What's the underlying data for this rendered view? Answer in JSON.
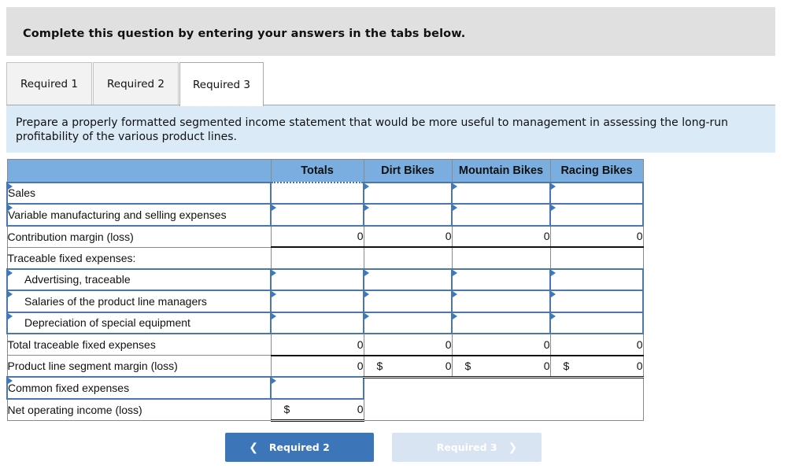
{
  "banner": {
    "text": "Complete this question by entering your answers in the tabs below."
  },
  "tabs": [
    {
      "label": "Required 1",
      "active": false
    },
    {
      "label": "Required 2",
      "active": false
    },
    {
      "label": "Required 3",
      "active": true
    }
  ],
  "instructions": "Prepare a properly formatted segmented income statement that would be more useful to management in assessing the long-run profitability of the various product lines.",
  "table": {
    "headers": [
      "",
      "Totals",
      "Dirt Bikes",
      "Mountain Bikes",
      "Racing Bikes"
    ],
    "rows": [
      {
        "label": "Sales",
        "type": "input",
        "cells": [
          "",
          "",
          "",
          ""
        ]
      },
      {
        "label": "Variable manufacturing and selling expenses",
        "type": "input",
        "cells": [
          "",
          "",
          "",
          ""
        ]
      },
      {
        "label": "Contribution margin (loss)",
        "type": "computed",
        "cells": [
          "0",
          "0",
          "0",
          "0"
        ]
      },
      {
        "label": "Traceable fixed expenses:",
        "type": "heading",
        "cells": [
          "",
          "",
          "",
          ""
        ]
      },
      {
        "label": "Advertising, traceable",
        "type": "input",
        "cells": [
          "",
          "",
          "",
          ""
        ]
      },
      {
        "label": "Salaries of the product line managers",
        "type": "input",
        "cells": [
          "",
          "",
          "",
          ""
        ]
      },
      {
        "label": "Depreciation of special equipment",
        "type": "input",
        "cells": [
          "",
          "",
          "",
          ""
        ]
      },
      {
        "label": "Total traceable fixed expenses",
        "type": "computed",
        "cells": [
          "0",
          "0",
          "0",
          "0"
        ]
      },
      {
        "label": "Product line segment margin (loss)",
        "type": "computed",
        "cells": [
          "0",
          "0",
          "0",
          "0"
        ],
        "dollar": [
          false,
          true,
          true,
          true
        ]
      },
      {
        "label": "Common fixed expenses",
        "type": "input",
        "cells": [
          ""
        ]
      },
      {
        "label": "Net operating income (loss)",
        "type": "computed",
        "cells": [
          "0"
        ],
        "dollar": [
          true
        ]
      }
    ],
    "currency_symbol": "$"
  },
  "nav": {
    "prev_label": "Required 2",
    "next_label": "Required 3",
    "prev_icon": "chevron-left-icon",
    "next_icon": "chevron-right-icon"
  },
  "colors": {
    "header_bg": "#7aaee0",
    "input_border": "#4a78ad",
    "instructions_bg": "#dbeaf7",
    "banner_bg": "#e0e0e0",
    "prev_button": "#3c76b8",
    "next_button_disabled": "#d8e4f1"
  }
}
